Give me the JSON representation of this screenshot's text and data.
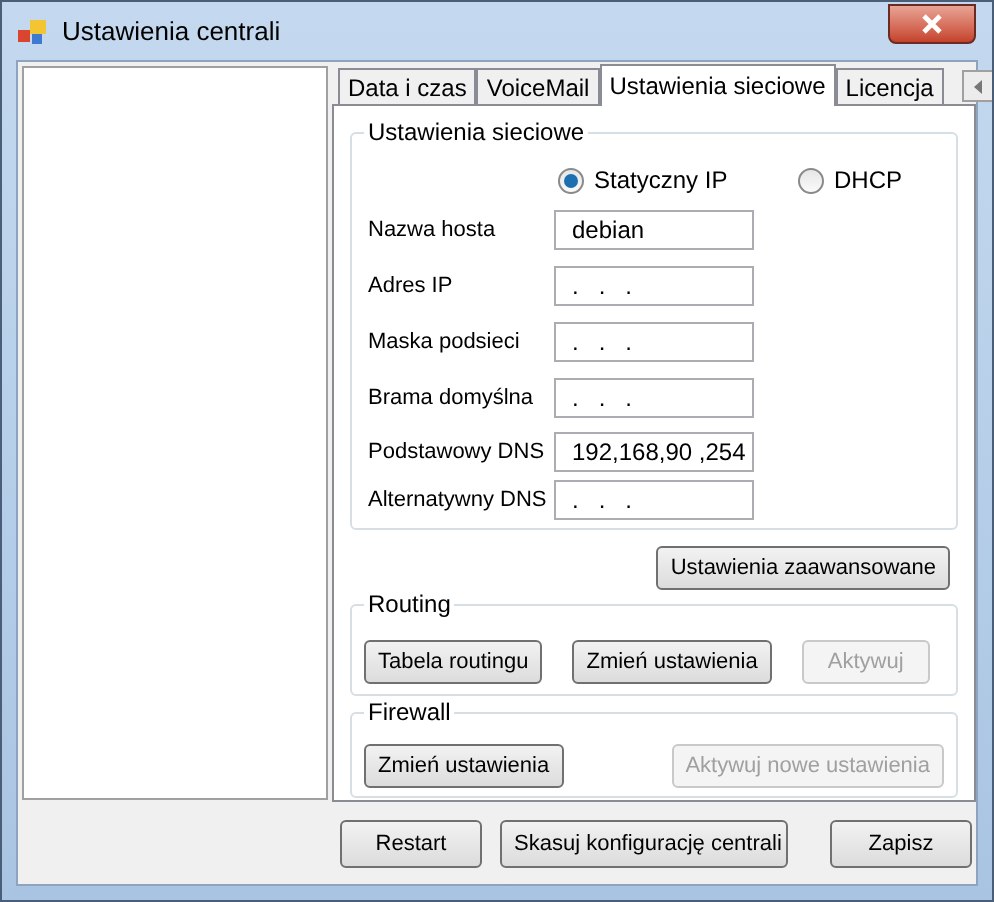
{
  "window": {
    "title": "Ustawienia centrali"
  },
  "tabs": [
    {
      "label": "Data i czas",
      "selected": false
    },
    {
      "label": "VoiceMail",
      "selected": false
    },
    {
      "label": "Ustawienia sieciowe",
      "selected": true
    },
    {
      "label": "Licencja",
      "selected": false
    }
  ],
  "network": {
    "title": "Ustawienia sieciowe",
    "modes": [
      {
        "label": "Statyczny IP",
        "selected": true
      },
      {
        "label": "DHCP",
        "selected": false
      }
    ],
    "fields": [
      {
        "label": "Nazwa hosta",
        "value": "debian"
      },
      {
        "label": "Adres IP",
        "value": ".   .   ."
      },
      {
        "label": "Maska podsieci",
        "value": ".   .   ."
      },
      {
        "label": "Brama domyślna",
        "value": ".   .   ."
      },
      {
        "label": "Podstawowy DNS",
        "value": "192,168,90 ,254"
      },
      {
        "label": "Alternatywny DNS",
        "value": ".   .   ."
      }
    ]
  },
  "advanced_button": "Ustawienia zaawansowane",
  "routing": {
    "title": "Routing",
    "buttons": [
      {
        "label": "Tabela routingu",
        "disabled": false
      },
      {
        "label": "Zmień ustawienia",
        "disabled": false
      },
      {
        "label": "Aktywuj",
        "disabled": true
      }
    ]
  },
  "firewall": {
    "title": "Firewall",
    "buttons": [
      {
        "label": "Zmień ustawienia",
        "disabled": false
      },
      {
        "label": "Aktywuj nowe ustawienia",
        "disabled": true
      }
    ]
  },
  "footer_buttons": [
    "Restart",
    "Skasuj konfigurację centrali",
    "Zapisz"
  ]
}
